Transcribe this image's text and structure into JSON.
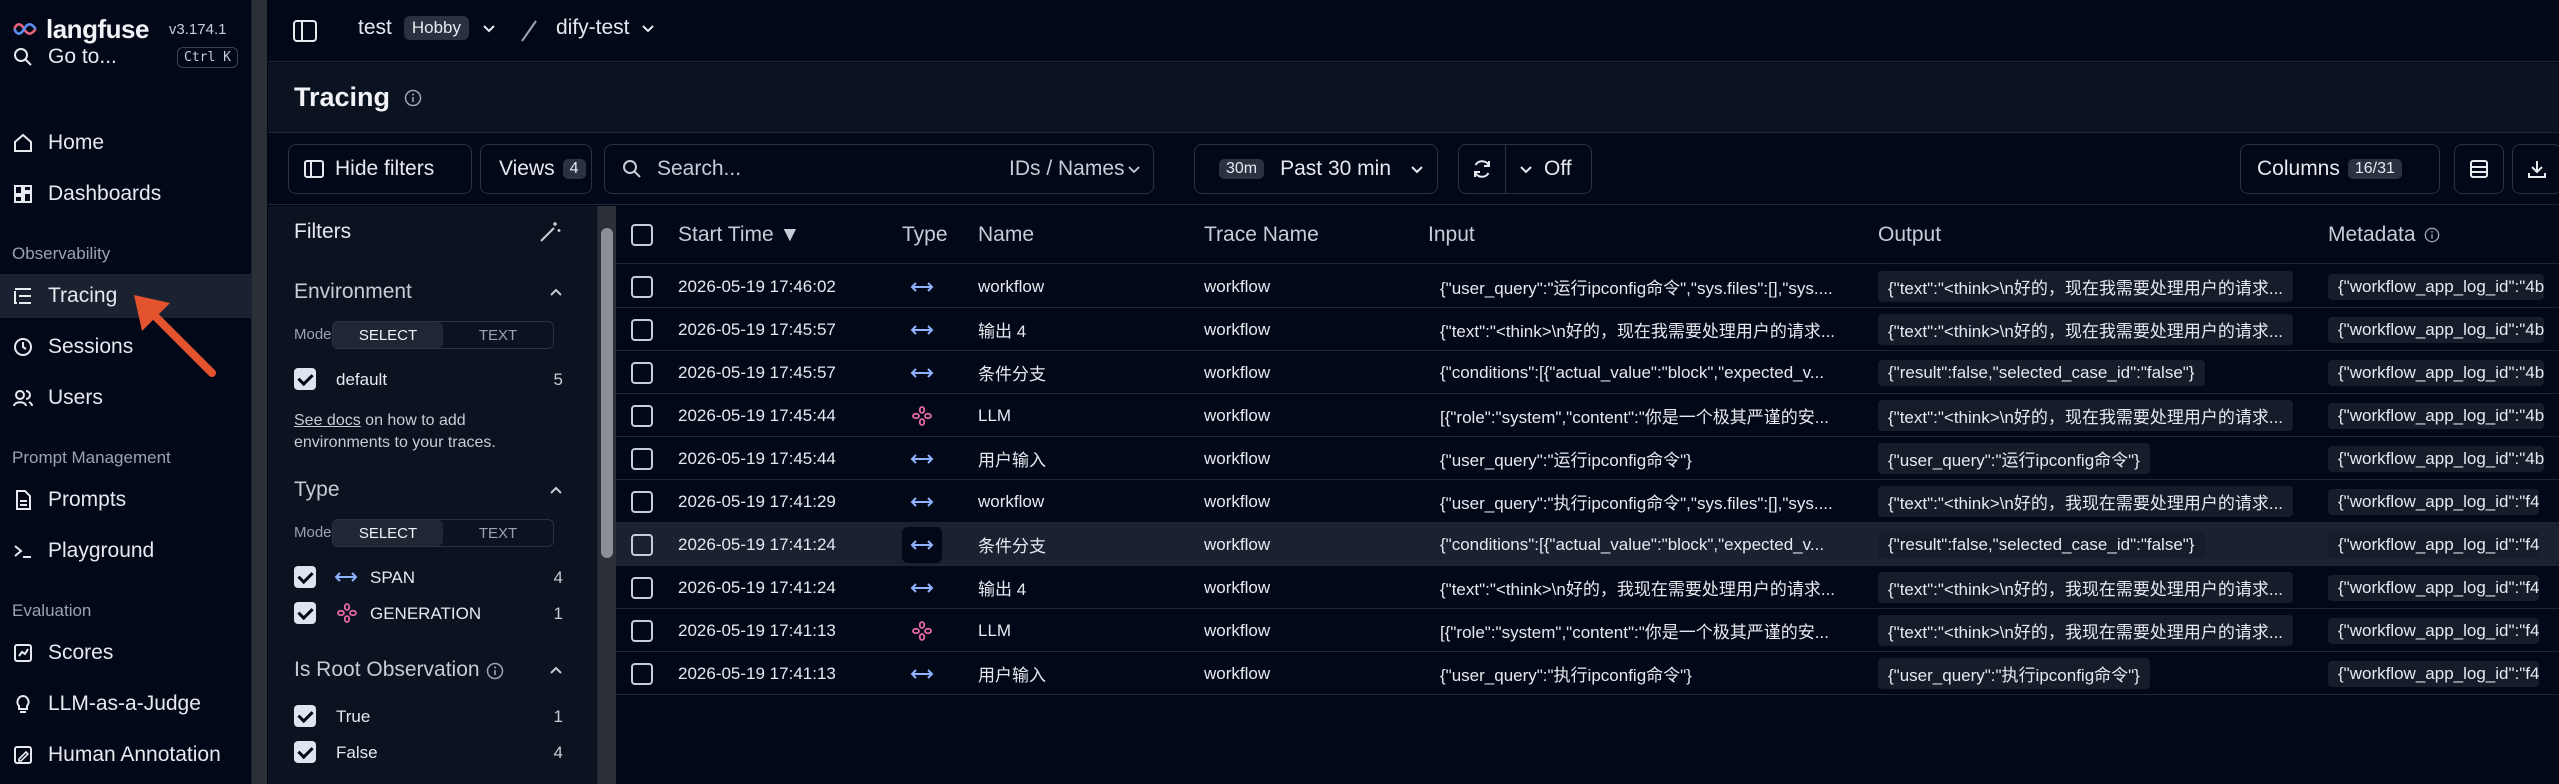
{
  "brand": {
    "name": "langfuse",
    "version": "v3.174.1"
  },
  "breadcrumb": {
    "org": "test",
    "plan": "Hobby",
    "project": "dify-test"
  },
  "sidebar": {
    "goto": {
      "label": "Go to...",
      "shortcut": "Ctrl K"
    },
    "home": "Home",
    "dashboards": "Dashboards",
    "section_observability": "Observability",
    "tracing": "Tracing",
    "sessions": "Sessions",
    "users": "Users",
    "section_prompt": "Prompt Management",
    "prompts": "Prompts",
    "playground": "Playground",
    "section_evaluation": "Evaluation",
    "scores": "Scores",
    "llm_judge": "LLM-as-a-Judge",
    "human_annotation": "Human Annotation"
  },
  "page": {
    "title": "Tracing"
  },
  "toolbar": {
    "hide_filters": "Hide filters",
    "views": "Views",
    "views_count": "4",
    "search_placeholder": "Search...",
    "search_scope": "IDs / Names",
    "time_badge": "30m",
    "time_label": "Past 30 min",
    "refresh_label": "Off",
    "columns": "Columns",
    "columns_count": "16/31"
  },
  "filters": {
    "title": "Filters",
    "environment": {
      "title": "Environment",
      "mode_label": "Mode:",
      "mode_select": "SELECT",
      "mode_text": "TEXT",
      "items": [
        {
          "label": "default",
          "count": "5"
        }
      ],
      "docs_link": "See docs",
      "docs_text_1": " on how to add",
      "docs_text_2": "environments to your traces."
    },
    "type": {
      "title": "Type",
      "mode_label": "Mode:",
      "mode_select": "SELECT",
      "mode_text": "TEXT",
      "items": [
        {
          "label": "SPAN",
          "count": "4"
        },
        {
          "label": "GENERATION",
          "count": "1"
        }
      ]
    },
    "root": {
      "title": "Is Root Observation",
      "items": [
        {
          "label": "True",
          "count": "1"
        },
        {
          "label": "False",
          "count": "4"
        }
      ]
    }
  },
  "table": {
    "columns": {
      "start_time": "Start Time ▼",
      "type": "Type",
      "name": "Name",
      "trace_name": "Trace Name",
      "input": "Input",
      "output": "Output",
      "metadata": "Metadata"
    },
    "rows": [
      {
        "time": "2026-05-19 17:46:02",
        "type": "span",
        "name": "workflow",
        "trace": "workflow",
        "input": "{\"user_query\":\"运行ipconfig命令\",\"sys.files\":[],\"sys....",
        "output": "{\"text\":\"<think>\\n好的，现在我需要处理用户的请求...",
        "metadata": "{\"workflow_app_log_id\":\"4b"
      },
      {
        "time": "2026-05-19 17:45:57",
        "type": "span",
        "name": "输出 4",
        "trace": "workflow",
        "input": "{\"text\":\"<think>\\n好的，现在我需要处理用户的请求...",
        "output": "{\"text\":\"<think>\\n好的，现在我需要处理用户的请求...",
        "metadata": "{\"workflow_app_log_id\":\"4b"
      },
      {
        "time": "2026-05-19 17:45:57",
        "type": "span",
        "name": "条件分支",
        "trace": "workflow",
        "input": "{\"conditions\":[{\"actual_value\":\"block\",\"expected_v...",
        "output": "{\"result\":false,\"selected_case_id\":\"false\"}",
        "metadata": "{\"workflow_app_log_id\":\"4b"
      },
      {
        "time": "2026-05-19 17:45:44",
        "type": "generation",
        "name": "LLM",
        "trace": "workflow",
        "input": "[{\"role\":\"system\",\"content\":\"你是一个极其严谨的安...",
        "output": "{\"text\":\"<think>\\n好的，现在我需要处理用户的请求...",
        "metadata": "{\"workflow_app_log_id\":\"4b"
      },
      {
        "time": "2026-05-19 17:45:44",
        "type": "span",
        "name": "用户输入",
        "trace": "workflow",
        "input": "{\"user_query\":\"运行ipconfig命令\"}",
        "output": "{\"user_query\":\"运行ipconfig命令\"}",
        "metadata": "{\"workflow_app_log_id\":\"4b"
      },
      {
        "time": "2026-05-19 17:41:29",
        "type": "span",
        "name": "workflow",
        "trace": "workflow",
        "input": "{\"user_query\":\"执行ipconfig命令\",\"sys.files\":[],\"sys....",
        "output": "{\"text\":\"<think>\\n好的，我现在需要处理用户的请求...",
        "metadata": "{\"workflow_app_log_id\":\"f4"
      },
      {
        "time": "2026-05-19 17:41:24",
        "type": "span",
        "name": "条件分支",
        "trace": "workflow",
        "input": "{\"conditions\":[{\"actual_value\":\"block\",\"expected_v...",
        "output": "{\"result\":false,\"selected_case_id\":\"false\"}",
        "metadata": "{\"workflow_app_log_id\":\"f4"
      },
      {
        "time": "2026-05-19 17:41:24",
        "type": "span",
        "name": "输出 4",
        "trace": "workflow",
        "input": "{\"text\":\"<think>\\n好的，我现在需要处理用户的请求...",
        "output": "{\"text\":\"<think>\\n好的，我现在需要处理用户的请求...",
        "metadata": "{\"workflow_app_log_id\":\"f4"
      },
      {
        "time": "2026-05-19 17:41:13",
        "type": "generation",
        "name": "LLM",
        "trace": "workflow",
        "input": "[{\"role\":\"system\",\"content\":\"你是一个极其严谨的安...",
        "output": "{\"text\":\"<think>\\n好的，我现在需要处理用户的请求...",
        "metadata": "{\"workflow_app_log_id\":\"f4"
      },
      {
        "time": "2026-05-19 17:41:13",
        "type": "span",
        "name": "用户输入",
        "trace": "workflow",
        "input": "{\"user_query\":\"执行ipconfig命令\"}",
        "output": "{\"user_query\":\"执行ipconfig命令\"}",
        "metadata": "{\"workflow_app_log_id\":\"f4"
      }
    ]
  },
  "colors": {
    "accent_arrow": "#e2532e",
    "span_icon": "#8fb4ff",
    "generation_icon": "#e86aa8"
  }
}
